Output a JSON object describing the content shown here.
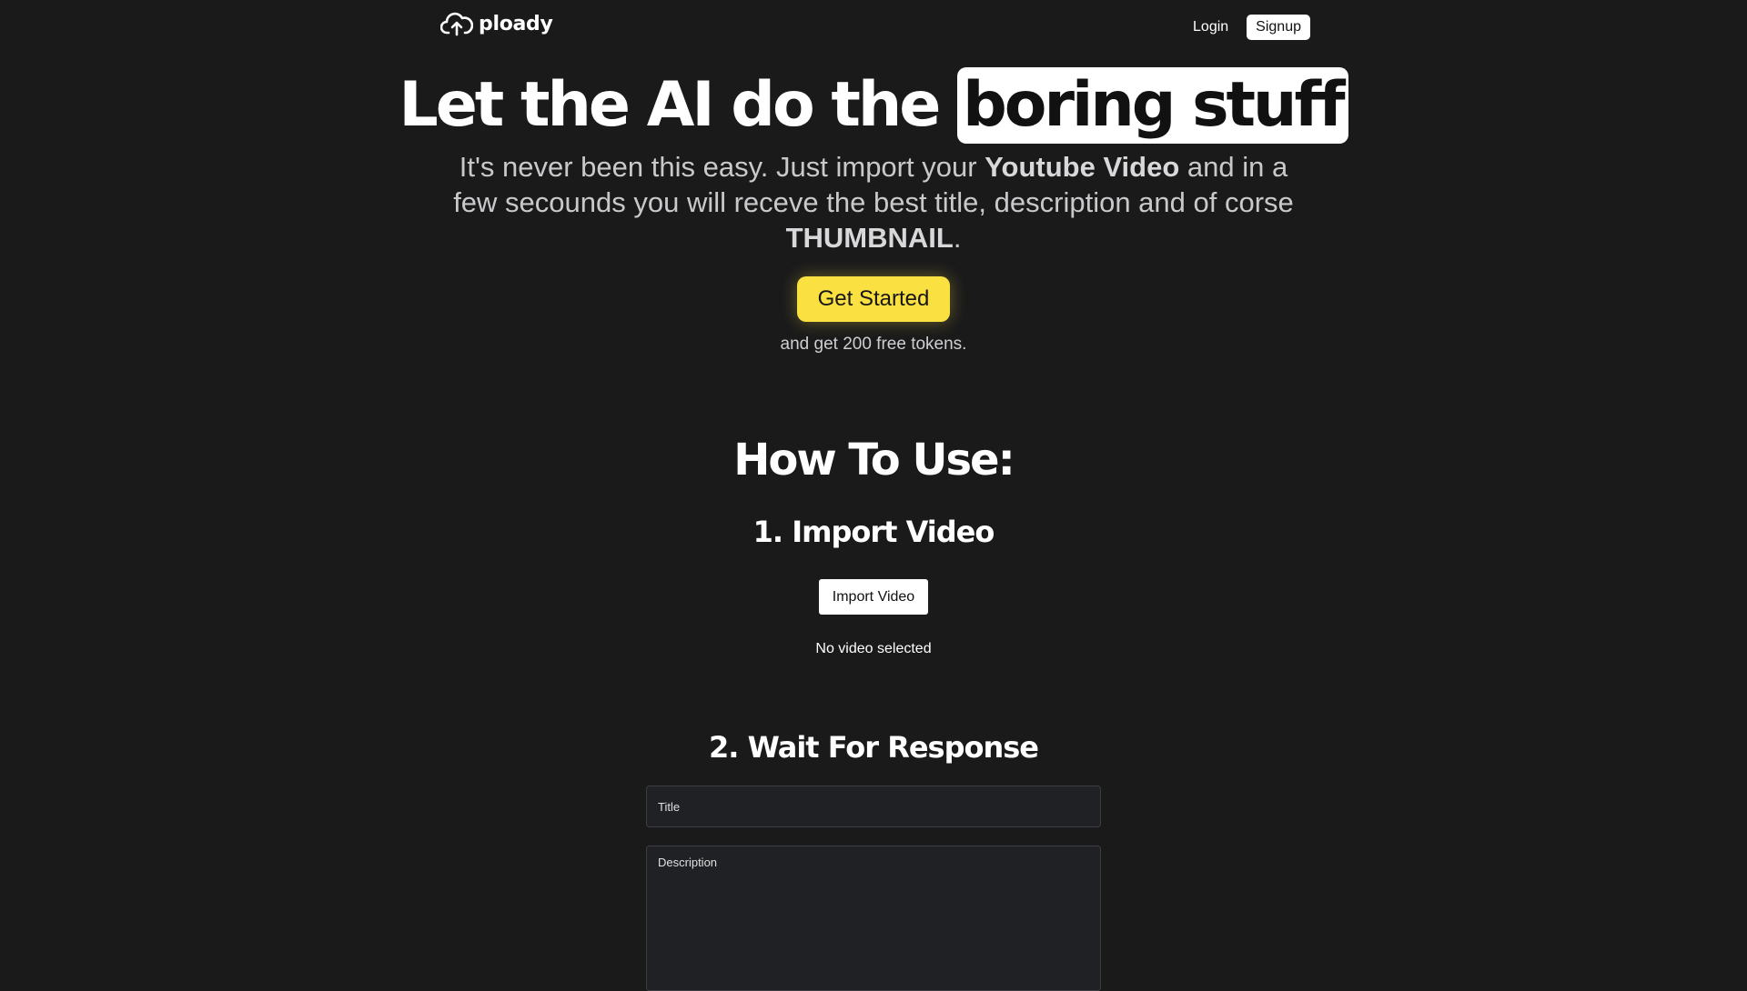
{
  "nav": {
    "logo_text": "ploady",
    "login_label": "Login",
    "signup_label": "Signup",
    "logo_icon": "cloud-upload-icon"
  },
  "hero": {
    "title_lead": "Let the AI do the ",
    "title_highlight": "boring stuff",
    "subtitle_part1": "It's never been this easy. Just import your ",
    "subtitle_bold1": "Youtube Video",
    "subtitle_part2": " and in a few secounds you will receve the best title, description and of corse ",
    "subtitle_bold2": "THUMBNAIL",
    "subtitle_part3": ".",
    "cta_label": "Get Started",
    "cta_note": "and get 200 free tokens."
  },
  "how_to": {
    "title": "How To Use:",
    "step1": {
      "title": "1. Import Video",
      "button_label": "Import Video",
      "status": "No video selected"
    },
    "step2": {
      "title": "2. Wait For Response",
      "title_placeholder": "Title",
      "description_placeholder": "Description"
    }
  },
  "colors": {
    "background": "#1a1a1b",
    "accent": "#fbe041",
    "text": "#ffffff",
    "muted_text": "#c9c9cb"
  }
}
